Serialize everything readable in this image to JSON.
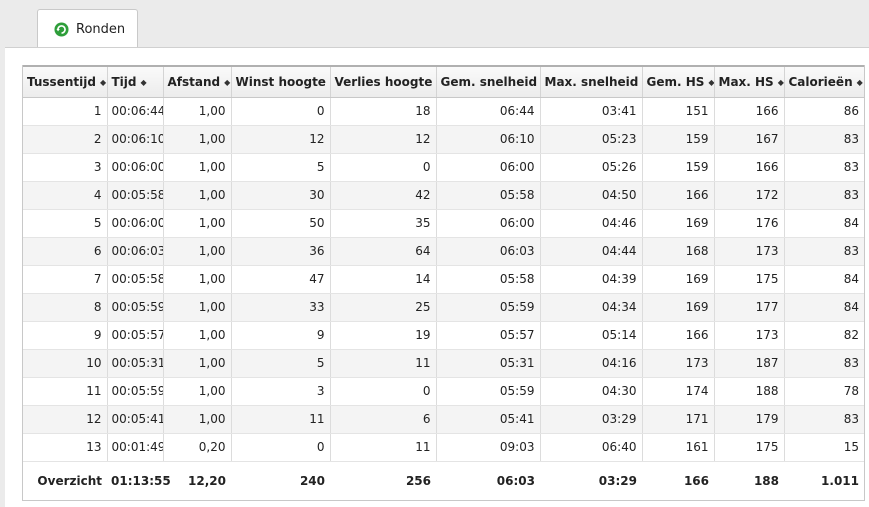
{
  "tab": {
    "label": "Ronden",
    "icon": "refresh-icon",
    "icon_color": "#2e9e3a"
  },
  "table": {
    "headers": [
      "Tussentijd",
      "Tijd",
      "Afstand",
      "Winst hoogte",
      "Verlies hoogte",
      "Gem. snelheid",
      "Max. snelheid",
      "Gem. HS",
      "Max. HS",
      "Calorieën"
    ],
    "rows": [
      [
        "1",
        "00:06:44",
        "1,00",
        "0",
        "18",
        "06:44",
        "03:41",
        "151",
        "166",
        "86"
      ],
      [
        "2",
        "00:06:10",
        "1,00",
        "12",
        "12",
        "06:10",
        "05:23",
        "159",
        "167",
        "83"
      ],
      [
        "3",
        "00:06:00",
        "1,00",
        "5",
        "0",
        "06:00",
        "05:26",
        "159",
        "166",
        "83"
      ],
      [
        "4",
        "00:05:58",
        "1,00",
        "30",
        "42",
        "05:58",
        "04:50",
        "166",
        "172",
        "83"
      ],
      [
        "5",
        "00:06:00",
        "1,00",
        "50",
        "35",
        "06:00",
        "04:46",
        "169",
        "176",
        "84"
      ],
      [
        "6",
        "00:06:03",
        "1,00",
        "36",
        "64",
        "06:03",
        "04:44",
        "168",
        "173",
        "83"
      ],
      [
        "7",
        "00:05:58",
        "1,00",
        "47",
        "14",
        "05:58",
        "04:39",
        "169",
        "175",
        "84"
      ],
      [
        "8",
        "00:05:59",
        "1,00",
        "33",
        "25",
        "05:59",
        "04:34",
        "169",
        "177",
        "84"
      ],
      [
        "9",
        "00:05:57",
        "1,00",
        "9",
        "19",
        "05:57",
        "05:14",
        "166",
        "173",
        "82"
      ],
      [
        "10",
        "00:05:31",
        "1,00",
        "5",
        "11",
        "05:31",
        "04:16",
        "173",
        "187",
        "83"
      ],
      [
        "11",
        "00:05:59",
        "1,00",
        "3",
        "0",
        "05:59",
        "04:30",
        "174",
        "188",
        "78"
      ],
      [
        "12",
        "00:05:41",
        "1,00",
        "11",
        "6",
        "05:41",
        "03:29",
        "171",
        "179",
        "83"
      ],
      [
        "13",
        "00:01:49",
        "0,20",
        "0",
        "11",
        "09:03",
        "06:40",
        "161",
        "175",
        "15"
      ]
    ],
    "summary": [
      "Overzicht",
      "01:13:55",
      "12,20",
      "240",
      "256",
      "06:03",
      "03:29",
      "166",
      "188",
      "1.011"
    ]
  }
}
